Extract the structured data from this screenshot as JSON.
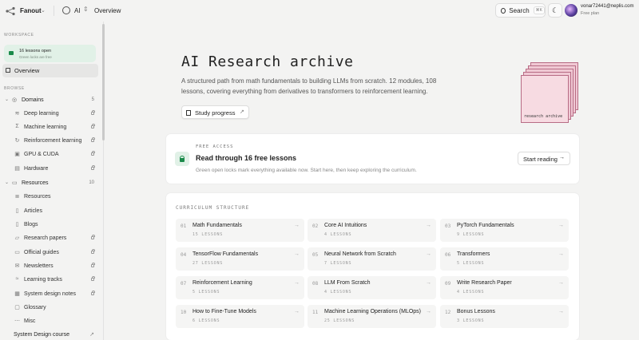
{
  "topbar": {
    "workspace": "Fanout",
    "project": "AI",
    "breadcrumb": "Overview",
    "search_label": "Search",
    "search_shortcut": "⌘K",
    "user_email": "vonar72441@neplis.com",
    "user_plan": "Free plan"
  },
  "sidebar": {
    "workspace_label": "WORKSPACE",
    "free_card": {
      "title": "16 lessons open",
      "subtitle": "Green locks are free"
    },
    "overview_label": "Overview",
    "browse_label": "BROWSE",
    "domains": {
      "label": "Domains",
      "count": "5",
      "items": [
        {
          "label": "Deep learning",
          "icon": "layers-icon"
        },
        {
          "label": "Machine learning",
          "icon": "sigma-icon"
        },
        {
          "label": "Reinforcement learning",
          "icon": "loop-icon"
        },
        {
          "label": "GPU & CUDA",
          "icon": "chip-icon"
        },
        {
          "label": "Hardware",
          "icon": "server-icon"
        }
      ]
    },
    "resources": {
      "label": "Resources",
      "count": "10",
      "items": [
        {
          "label": "Resources",
          "icon": "stack-icon",
          "locked": false
        },
        {
          "label": "Articles",
          "icon": "document-icon",
          "locked": false
        },
        {
          "label": "Blogs",
          "icon": "document-icon",
          "locked": false
        },
        {
          "label": "Research papers",
          "icon": "paper-icon",
          "locked": true
        },
        {
          "label": "Official guides",
          "icon": "book-icon",
          "locked": true
        },
        {
          "label": "Newsletters",
          "icon": "mail-icon",
          "locked": true
        },
        {
          "label": "Learning tracks",
          "icon": "path-icon",
          "locked": true
        },
        {
          "label": "System design notes",
          "icon": "note-icon",
          "locked": true
        },
        {
          "label": "Glossary",
          "icon": "glossary-icon",
          "locked": false
        },
        {
          "label": "Misc",
          "icon": "dots-icon",
          "locked": false
        }
      ]
    },
    "external_link": "System Design course"
  },
  "hero": {
    "title": "AI Research archive",
    "description": "A structured path from math fundamentals to building LLMs from scratch. 12 modules, 108 lessons, covering everything from derivatives to transformers to reinforcement learning.",
    "study_button": "Study progress",
    "illustration_text": "research archive"
  },
  "free_access": {
    "kicker": "FREE ACCESS",
    "heading": "Read through 16 free lessons",
    "subtext": "Green open locks mark everything available now. Start here, then keep exploring the curriculum.",
    "button": "Start reading"
  },
  "curriculum": {
    "kicker": "CURRICULUM STRUCTURE",
    "modules": [
      {
        "num": "01",
        "title": "Math Fundamentals",
        "count": "15 LESSONS"
      },
      {
        "num": "02",
        "title": "Core AI Intuitions",
        "count": "4 LESSONS"
      },
      {
        "num": "03",
        "title": "PyTorch Fundamentals",
        "count": "9 LESSONS"
      },
      {
        "num": "04",
        "title": "TensorFlow Fundamentals",
        "count": "27 LESSONS"
      },
      {
        "num": "05",
        "title": "Neural Network from Scratch",
        "count": "7 LESSONS"
      },
      {
        "num": "06",
        "title": "Transformers",
        "count": "5 LESSONS"
      },
      {
        "num": "07",
        "title": "Reinforcement Learning",
        "count": "5 LESSONS"
      },
      {
        "num": "08",
        "title": "LLM From Scratch",
        "count": "4 LESSONS"
      },
      {
        "num": "09",
        "title": "Write Research Paper",
        "count": "4 LESSONS"
      },
      {
        "num": "10",
        "title": "How to Fine-Tune Models",
        "count": "6 LESSONS"
      },
      {
        "num": "11",
        "title": "Machine Learning Operations (MLOps)",
        "count": "25 LESSONS"
      },
      {
        "num": "12",
        "title": "Bonus Lessons",
        "count": "3 LESSONS"
      }
    ]
  },
  "colors": {
    "accent_green": "#1a8a4a",
    "free_card_bg": "#e1f1e7",
    "illustration_pink": "#f0c9d4"
  }
}
